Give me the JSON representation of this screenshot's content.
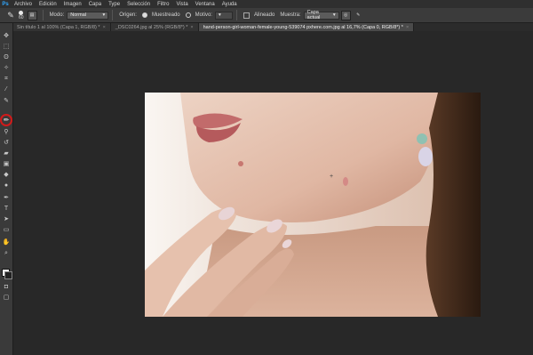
{
  "app": {
    "logo": "Ps"
  },
  "menu": {
    "items": [
      "Archivo",
      "Edición",
      "Imagen",
      "Capa",
      "Type",
      "Selección",
      "Filtro",
      "Vista",
      "Ventana",
      "Ayuda"
    ]
  },
  "options": {
    "brush_size": "60",
    "mode_label": "Modo:",
    "mode_value": "Normal",
    "origin_label": "Origen:",
    "origin_sampled": "Muestreado",
    "origin_pattern": "Motivo:",
    "aligned_label": "Alineado",
    "sample_label": "Muestra:",
    "sample_value": "Capa actual"
  },
  "tabs": [
    {
      "label": "Sin título 1 al 100% (Capa 1, RGB/8) *",
      "active": false
    },
    {
      "label": "_DSC0264.jpg al 25% (RGB/8*) *",
      "active": false
    },
    {
      "label": "hand-person-girl-woman-female-young-539074 pxhere.com.jpg al 16,7% (Capa 0, RGB/8*) *",
      "active": true
    }
  ],
  "toolbar": {
    "tools": [
      "move-icon",
      "marquee-icon",
      "lasso-icon",
      "quick-select-icon",
      "crop-icon",
      "eyedropper-icon",
      "spot-healing-icon",
      "brush-icon",
      "clone-stamp-icon",
      "history-brush-icon",
      "eraser-icon",
      "gradient-icon",
      "blur-icon",
      "dodge-icon",
      "pen-icon",
      "type-icon",
      "path-select-icon",
      "shape-icon",
      "hand-icon",
      "zoom-icon"
    ],
    "highlighted_tool": "spot-healing-icon",
    "highlight_color": "#d11a1a"
  },
  "colors": {
    "foreground": "#ffffff",
    "background": "#222222"
  }
}
